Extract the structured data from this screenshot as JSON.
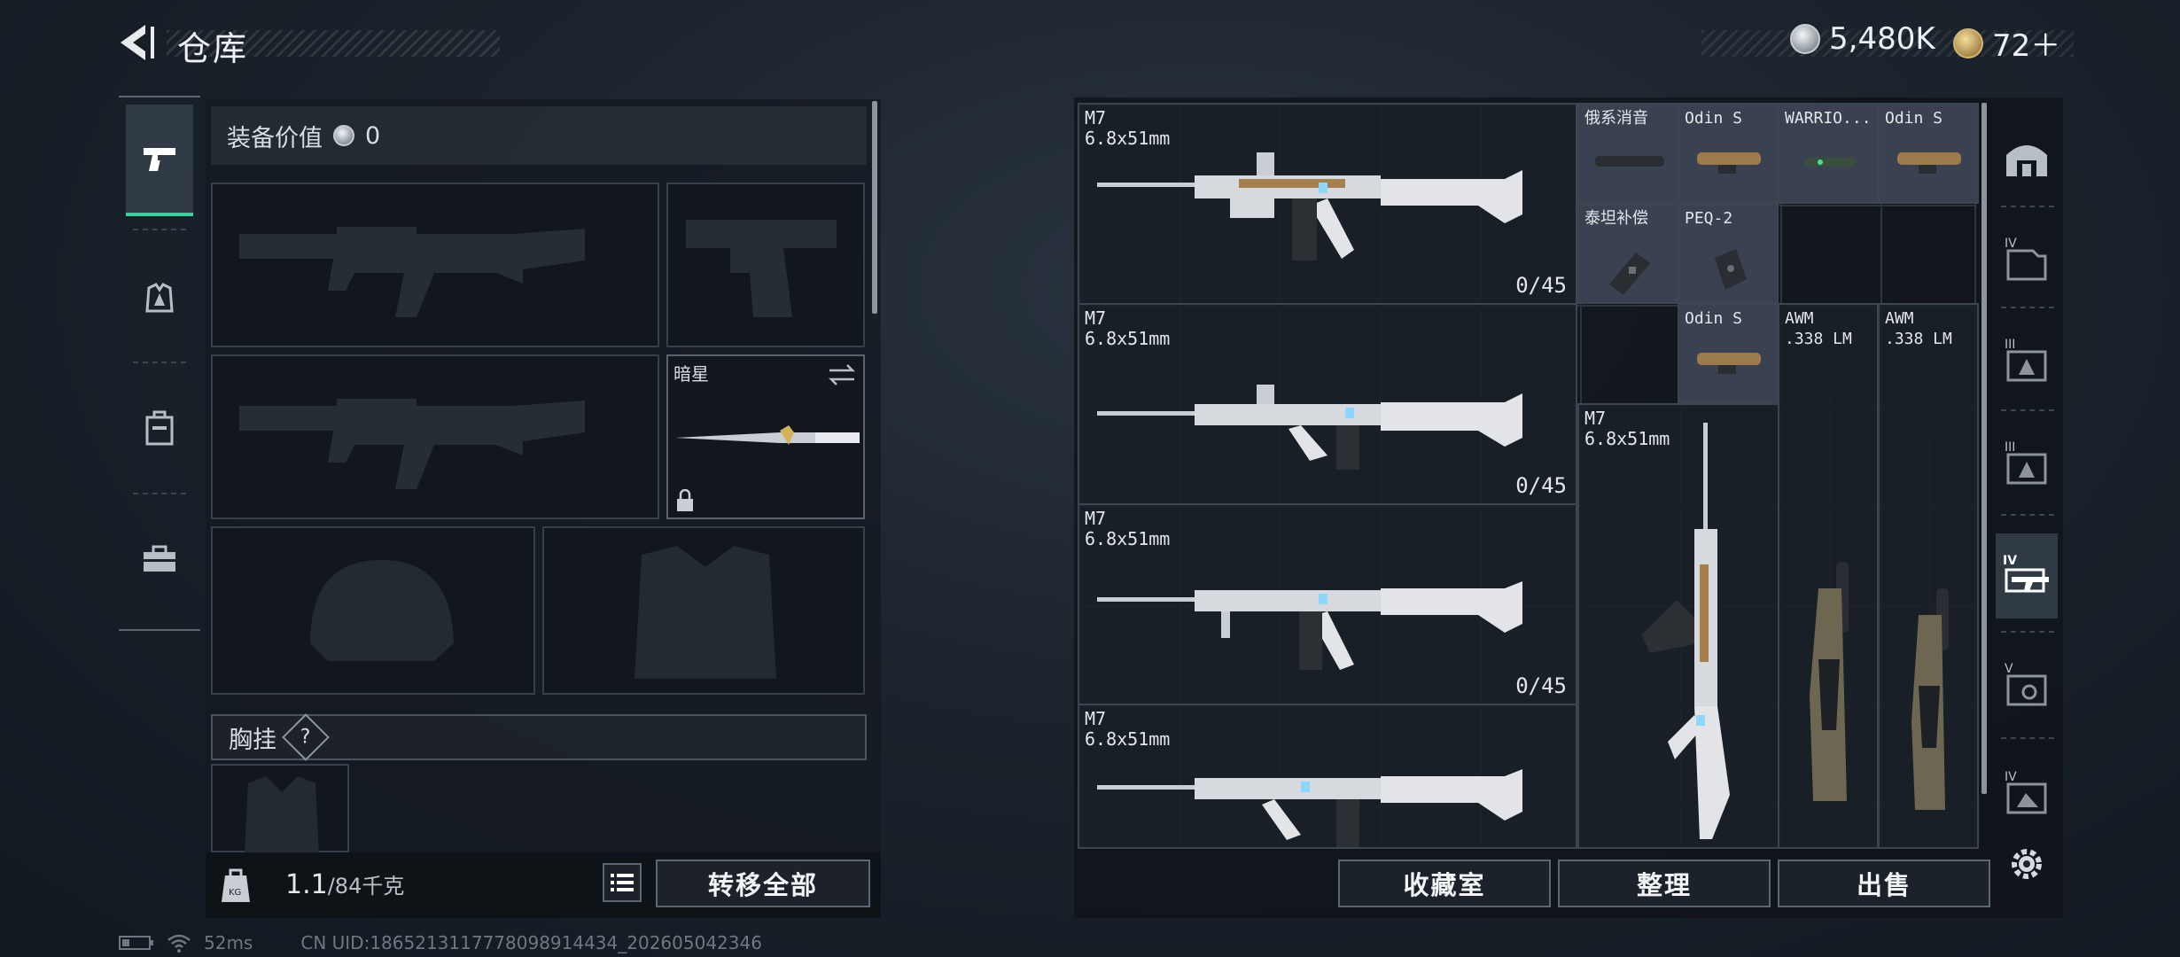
{
  "header": {
    "title": "仓库",
    "currency_silver": "5,480K",
    "currency_gold": "72＋"
  },
  "tabs": [
    {
      "name": "tab-weapons",
      "icon": "pistol-icon",
      "active": true
    },
    {
      "name": "tab-armor",
      "icon": "armor-rig-icon",
      "active": false
    },
    {
      "name": "tab-backpack",
      "icon": "backpack-icon",
      "active": false
    },
    {
      "name": "tab-container",
      "icon": "toolbox-icon",
      "active": false
    }
  ],
  "loadout": {
    "value_label": "装备价值",
    "value": "0",
    "melee_name": "暗星",
    "chest_label": "胸挂",
    "help": "?"
  },
  "bag": {
    "weight_current": "1.1",
    "weight_max": "/84千克",
    "transfer_all": "转移全部"
  },
  "storage": {
    "rifles": [
      {
        "name": "M7",
        "caliber": "6.8x51mm",
        "ammo": "0/45"
      },
      {
        "name": "M7",
        "caliber": "6.8x51mm",
        "ammo": "0/45"
      },
      {
        "name": "M7",
        "caliber": "6.8x51mm",
        "ammo": "0/45"
      },
      {
        "name": "M7",
        "caliber": "6.8x51mm",
        "ammo": ""
      }
    ],
    "attachments_row1": [
      "俄系消音",
      "Odin S",
      "WARRIO...",
      "Odin S"
    ],
    "attachments_row2": [
      "泰坦补偿",
      "PEQ-2"
    ],
    "row3": [
      {
        "name": "Odin S"
      },
      {
        "name": "AWM",
        "caliber": ".338 LM"
      },
      {
        "name": "AWM",
        "caliber": ".338 LM"
      }
    ],
    "vertical_rifle": {
      "name": "M7",
      "caliber": "6.8x51mm"
    }
  },
  "bottom_buttons": {
    "collection": "收藏室",
    "sort": "整理",
    "sell": "出售"
  },
  "status_bar": {
    "ping": "52ms",
    "uid": "CN UID:1865213117778098914434_202605042346"
  },
  "colors": {
    "accent_green": "#36d098",
    "attachment_bg": "#3a4150"
  }
}
